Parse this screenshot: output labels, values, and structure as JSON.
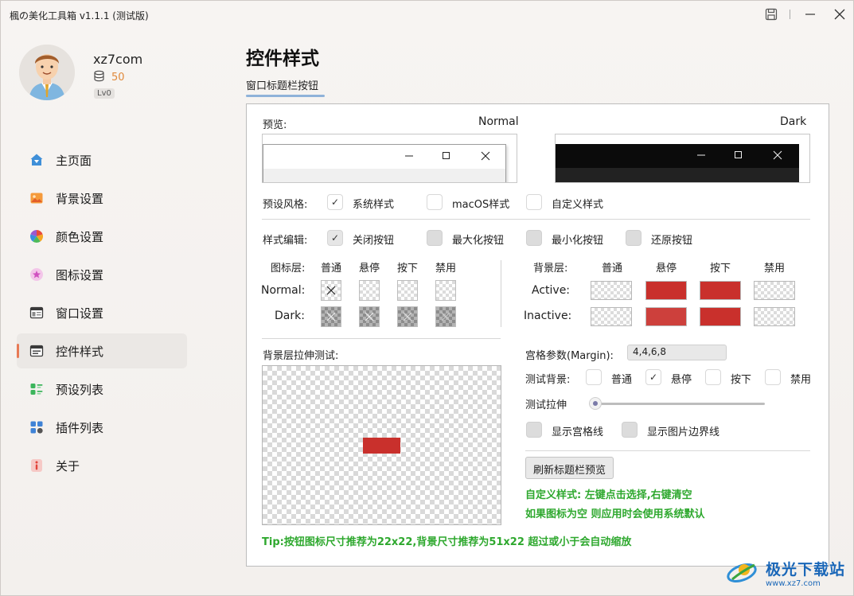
{
  "window": {
    "title": "楓の美化工具箱 v1.1.1 (测试版)"
  },
  "user": {
    "name": "xz7com",
    "coins": "50",
    "level": "Lv0"
  },
  "sidebar": {
    "items": [
      {
        "label": "主页面",
        "icon": "home-icon",
        "active": false
      },
      {
        "label": "背景设置",
        "icon": "image-icon",
        "active": false
      },
      {
        "label": "颜色设置",
        "icon": "color-wheel-icon",
        "active": false
      },
      {
        "label": "图标设置",
        "icon": "star-icon",
        "active": false
      },
      {
        "label": "窗口设置",
        "icon": "window-icon",
        "active": false
      },
      {
        "label": "控件样式",
        "icon": "control-icon",
        "active": true
      },
      {
        "label": "预设列表",
        "icon": "list-icon",
        "active": false
      },
      {
        "label": "插件列表",
        "icon": "plugin-icon",
        "active": false
      },
      {
        "label": "关于",
        "icon": "info-icon",
        "active": false
      }
    ]
  },
  "main": {
    "title": "控件样式",
    "tab": "窗口标题栏按钮",
    "preview": {
      "label": "预览:",
      "normal": "Normal",
      "dark": "Dark"
    },
    "preset": {
      "label": "预设风格:",
      "options": [
        {
          "label": "系统样式",
          "checked": true
        },
        {
          "label": "macOS样式",
          "checked": false
        },
        {
          "label": "自定义样式",
          "checked": false
        }
      ]
    },
    "edit": {
      "label": "样式编辑:",
      "options": [
        {
          "label": "关闭按钮",
          "checked": true
        },
        {
          "label": "最大化按钮",
          "checked": false
        },
        {
          "label": "最小化按钮",
          "checked": false
        },
        {
          "label": "还原按钮",
          "checked": false
        }
      ]
    },
    "icon_layer": {
      "label": "图标层:",
      "cols": [
        "普通",
        "悬停",
        "按下",
        "禁用"
      ],
      "rows": [
        "Normal:",
        "Dark:"
      ]
    },
    "bg_layer": {
      "label": "背景层:",
      "cols": [
        "普通",
        "悬停",
        "按下",
        "禁用"
      ],
      "rows": [
        "Active:",
        "Inactive:"
      ]
    },
    "stretch_test": {
      "label": "背景层拉伸测试:"
    },
    "margin": {
      "label": "宫格参数(Margin):",
      "value": "4,4,6,8"
    },
    "test_bg": {
      "label": "测试背景:",
      "options": [
        {
          "label": "普通",
          "checked": false
        },
        {
          "label": "悬停",
          "checked": true
        },
        {
          "label": "按下",
          "checked": false
        },
        {
          "label": "禁用",
          "checked": false
        }
      ]
    },
    "test_stretch": {
      "label": "测试拉伸",
      "value": 0.0
    },
    "show_grid": "显示宫格线",
    "show_border": "显示图片边界线",
    "refresh_button": "刷新标题栏预览",
    "hint1": "自定义样式: 左键点击选择,右键清空",
    "hint2": "如果图标为空 则应用时会使用系统默认",
    "tip": "Tip:按钮图标尺寸推荐为22x22,背景尺寸推荐为51x22 超过或小于会自动缩放"
  },
  "watermark": {
    "text": "极光下载站",
    "url": "www.xz7.com"
  },
  "colors": {
    "accent": "#e87a55",
    "red": "#c9302c",
    "green": "#2ea82e",
    "tab_underline": "#8fb2d9"
  }
}
